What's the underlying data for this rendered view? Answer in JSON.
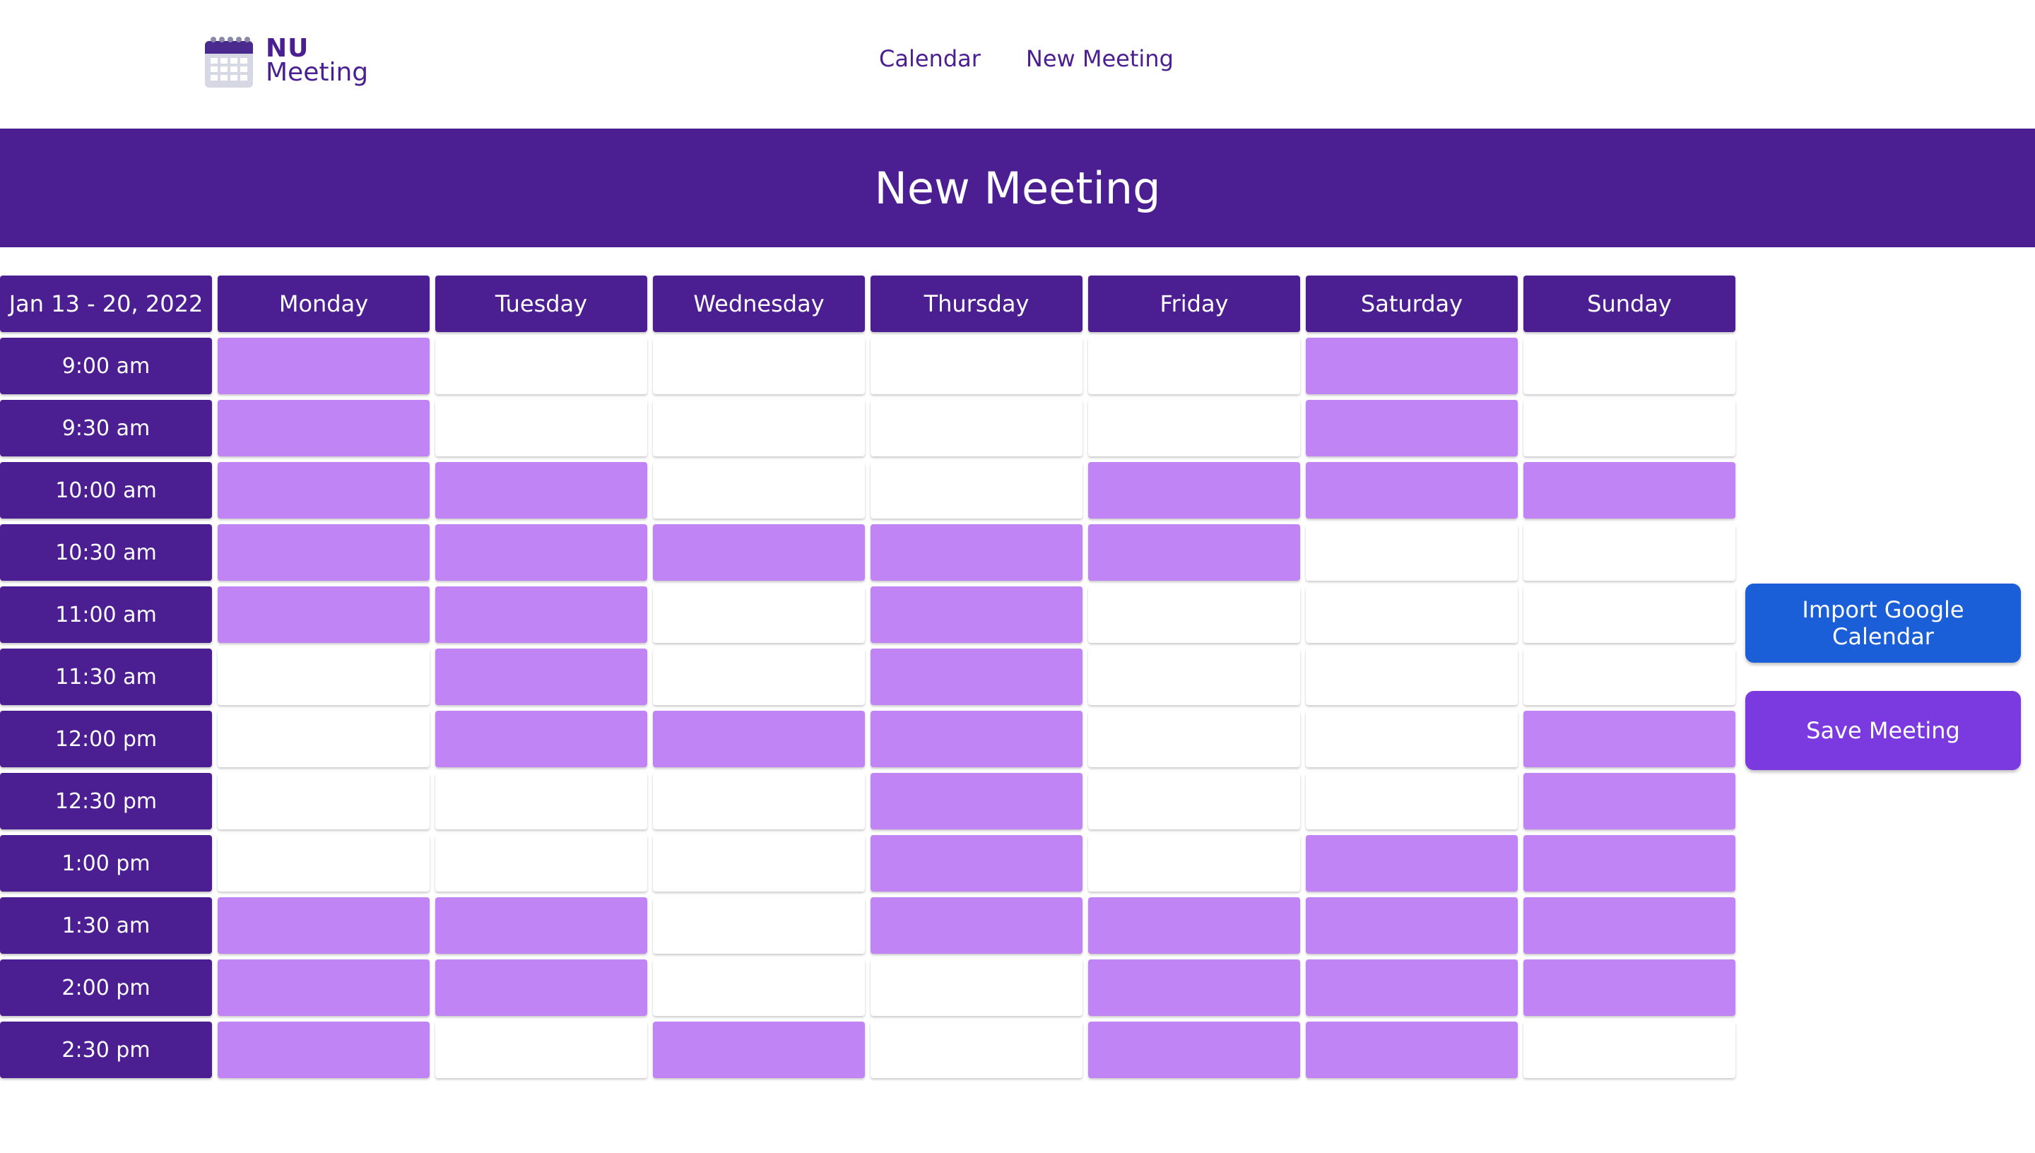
{
  "brand": {
    "line1": "NU",
    "line2": "Meeting",
    "icon": "calendar-icon",
    "color": "#4a1f91"
  },
  "nav": {
    "items": [
      "Calendar",
      "New Meeting"
    ]
  },
  "banner": {
    "title": "New Meeting",
    "color": "#4b1e92"
  },
  "schedule": {
    "range_label": "Jan 13 - 20, 2022",
    "days": [
      "Monday",
      "Tuesday",
      "Wednesday",
      "Thursday",
      "Friday",
      "Saturday",
      "Sunday"
    ],
    "times": [
      "9:00 am",
      "9:30 am",
      "10:00 am",
      "10:30 am",
      "11:00 am",
      "11:30 am",
      "12:00 pm",
      "12:30 pm",
      "1:00 pm",
      "1:30 am",
      "2:00 pm",
      "2:30 pm"
    ],
    "available_color": "#c084f5",
    "availability": [
      [
        1,
        0,
        0,
        0,
        0,
        1,
        0
      ],
      [
        1,
        0,
        0,
        0,
        0,
        1,
        0
      ],
      [
        1,
        1,
        0,
        0,
        1,
        1,
        1
      ],
      [
        1,
        1,
        1,
        1,
        1,
        0,
        0
      ],
      [
        1,
        1,
        0,
        1,
        0,
        0,
        0
      ],
      [
        0,
        1,
        0,
        1,
        0,
        0,
        0
      ],
      [
        0,
        1,
        1,
        1,
        0,
        0,
        1
      ],
      [
        0,
        0,
        0,
        1,
        0,
        0,
        1
      ],
      [
        0,
        0,
        0,
        1,
        0,
        1,
        1
      ],
      [
        1,
        1,
        0,
        1,
        1,
        1,
        1
      ],
      [
        1,
        1,
        0,
        0,
        1,
        1,
        1
      ],
      [
        1,
        0,
        1,
        0,
        1,
        1,
        0
      ]
    ]
  },
  "actions": {
    "import_label": "Import Google Calendar",
    "import_color": "#1a5fd8",
    "save_label": "Save Meeting",
    "save_color": "#7a3ae0"
  }
}
